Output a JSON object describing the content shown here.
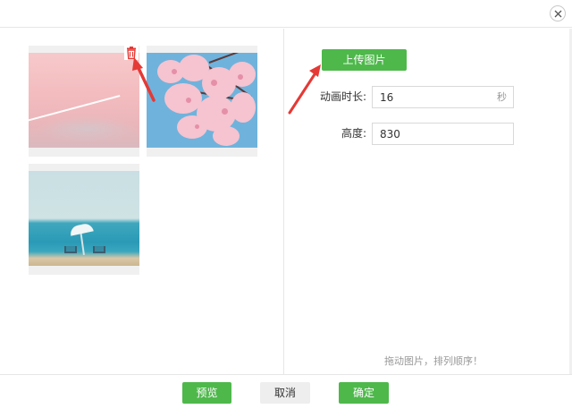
{
  "dialog": {
    "close_icon": "close-icon"
  },
  "images": {
    "items": [
      {
        "name": "pink-sky-airplane-trail"
      },
      {
        "name": "cherry-blossoms"
      },
      {
        "name": "beach-sea-chairs"
      }
    ],
    "delete_icon": "trash-icon"
  },
  "form": {
    "upload_label": "上传图片",
    "duration_label": "动画时长:",
    "duration_value": "16",
    "duration_unit": "秒",
    "height_label": "高度:",
    "height_value": "830",
    "hint": "拖动图片，排列顺序！"
  },
  "footer": {
    "preview_label": "预览",
    "cancel_label": "取消",
    "confirm_label": "确定"
  },
  "annotations": {
    "arrow_color": "#e53935"
  },
  "colors": {
    "accent": "#4eb84b",
    "border": "#e6e6e6",
    "muted_text": "#999999"
  }
}
